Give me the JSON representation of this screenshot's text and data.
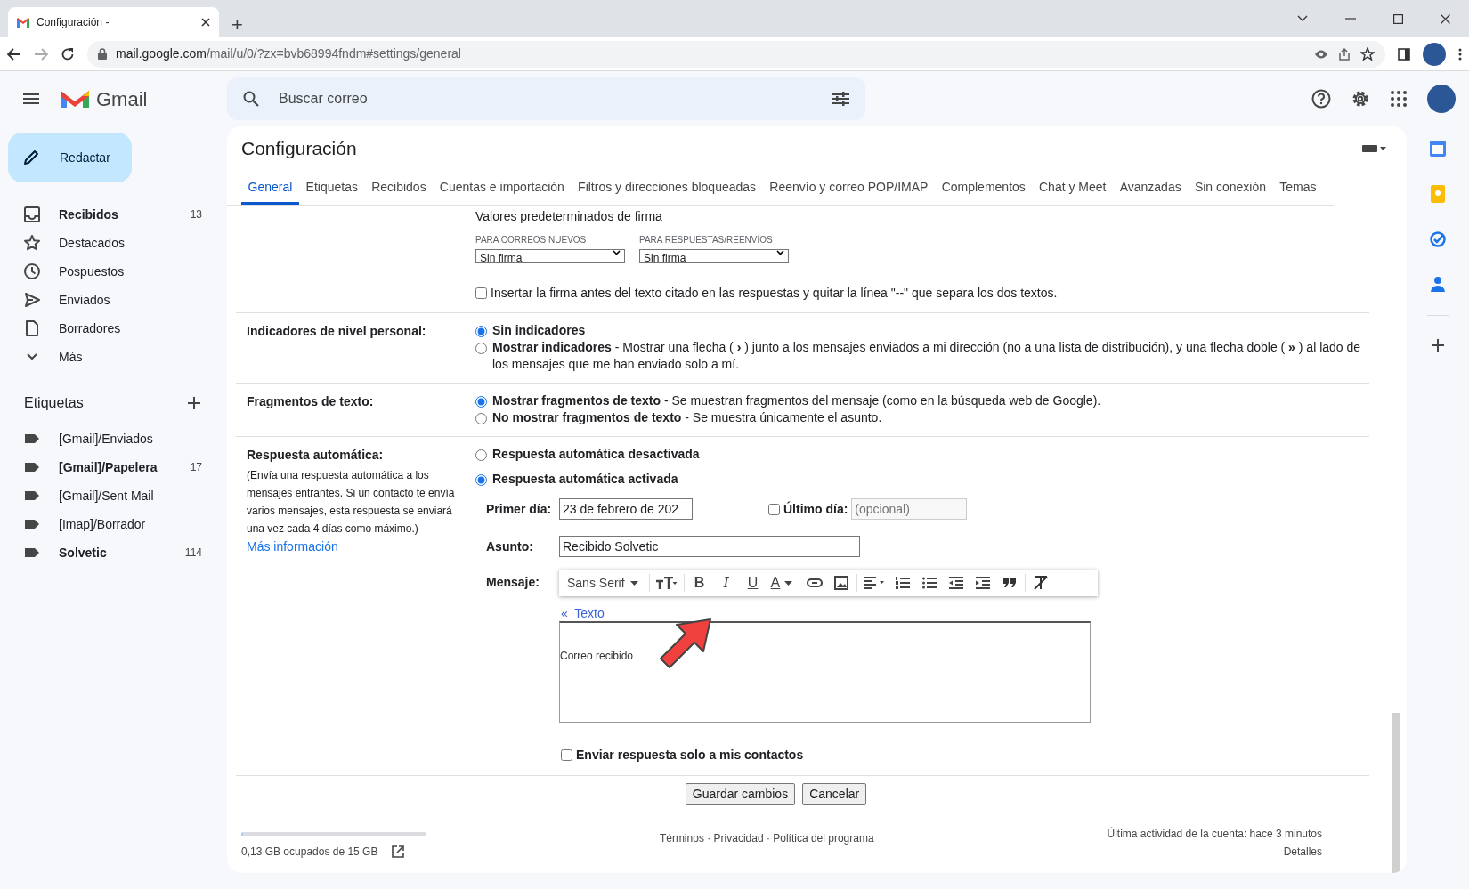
{
  "browser": {
    "tab_title": "Configuración -",
    "new_tab": "+",
    "url_host": "mail.google.com",
    "url_path": "/mail/u/0/?zx=bvb68994fndm#settings/general"
  },
  "app": {
    "name": "Gmail",
    "search": {
      "placeholder": "Buscar correo"
    }
  },
  "compose": {
    "label": "Redactar"
  },
  "sidebar": {
    "items": [
      {
        "label": "Recibidos",
        "count": "13",
        "unread": true
      },
      {
        "label": "Destacados",
        "unread": false
      },
      {
        "label": "Pospuestos",
        "unread": false
      },
      {
        "label": "Enviados",
        "unread": false
      },
      {
        "label": "Borradores",
        "unread": false
      },
      {
        "label": "Más",
        "unread": false
      }
    ],
    "labels_title": "Etiquetas",
    "labels": [
      {
        "label": "[Gmail]/Enviados",
        "unread": false
      },
      {
        "label": "[Gmail]/Papelera",
        "count": "17",
        "unread": true
      },
      {
        "label": "[Gmail]/Sent Mail",
        "unread": false
      },
      {
        "label": "[Imap]/Borrador",
        "unread": false
      },
      {
        "label": "Solvetic",
        "count": "114",
        "unread": true
      }
    ]
  },
  "settings": {
    "title": "Configuración",
    "tabs": [
      {
        "label": "General",
        "selected": true
      },
      {
        "label": "Etiquetas",
        "selected": false
      },
      {
        "label": "Recibidos",
        "selected": false
      },
      {
        "label": "Cuentas e importación",
        "selected": false
      },
      {
        "label": "Filtros y direcciones bloqueadas",
        "selected": false
      },
      {
        "label": "Reenvío y correo POP/IMAP",
        "selected": false
      },
      {
        "label": "Complementos",
        "selected": false
      },
      {
        "label": "Chat y Meet",
        "selected": false
      },
      {
        "label": "Avanzadas",
        "selected": false
      },
      {
        "label": "Sin conexión",
        "selected": false
      },
      {
        "label": "Temas",
        "selected": false
      }
    ],
    "signature": {
      "title": "Valores predeterminados de firma",
      "new_label": "PARA CORREOS NUEVOS",
      "new_value": "Sin firma",
      "reply_label": "PARA RESPUESTAS/REENVÍOS",
      "reply_value": "Sin firma",
      "insert_before": {
        "label": "Insertar la firma antes del texto citado en las respuestas y quitar la línea \"--\" que separa los dos textos.",
        "checked": false
      }
    },
    "sections": [
      {
        "label": "Indicadores de nivel personal:",
        "options": [
          {
            "text": "**Sin indicadores**",
            "selected": true
          },
          {
            "text": "**Mostrar indicadores** - Mostrar una flecha ( **›** ) junto a los mensajes enviados a mi dirección (no a una lista de distribución), y una flecha doble ( **»** ) al lado de los mensajes que me han enviado solo a mí.",
            "selected": false
          }
        ]
      },
      {
        "label": "Fragmentos de texto:",
        "options": [
          {
            "text": "**Mostrar fragmentos de texto** - Se muestran fragmentos del mensaje (como en la búsqueda web de Google).",
            "selected": true
          },
          {
            "text": "**No mostrar fragmentos de texto** - Se muestra únicamente el asunto.",
            "selected": false
          }
        ]
      }
    ],
    "vacation": {
      "label": "Respuesta automática:",
      "description": "(Envía una respuesta automática a los mensajes entrantes. Si un contacto te envía varios mensajes, esta respuesta se enviará una vez cada 4 días como máximo.)",
      "link": "Más información",
      "options": [
        {
          "text": "Respuesta automática desactivada",
          "selected": false
        },
        {
          "text": "Respuesta automática activada",
          "selected": true
        }
      ],
      "first_day_label": "Primer día:",
      "first_day_value": "23 de febrero de 202",
      "last_day": {
        "label": "Último día:",
        "checked": false,
        "placeholder": "(opcional)"
      },
      "subject_label": "Asunto:",
      "subject_value": "Recibido Solvetic",
      "message_label": "Mensaje:",
      "toolbar": [
        {
          "kind": "font",
          "text": "Sans Serif"
        },
        {
          "kind": "size"
        },
        {
          "kind": "bold",
          "text": "B"
        },
        {
          "kind": "italic",
          "text": "I"
        },
        {
          "kind": "underline",
          "text": "U"
        },
        {
          "kind": "color",
          "text": "A"
        },
        {
          "kind": "link"
        },
        {
          "kind": "image"
        },
        {
          "kind": "align"
        },
        {
          "kind": "numbered"
        },
        {
          "kind": "bulleted"
        },
        {
          "kind": "outdent"
        },
        {
          "kind": "indent"
        },
        {
          "kind": "quote"
        },
        {
          "kind": "clear"
        }
      ],
      "plain_text_link": "«  Texto",
      "message_body": "Correo recibido",
      "contacts_only": {
        "label": "Enviar respuesta solo a mis contactos",
        "checked": false
      }
    },
    "buttons": [
      "Guardar cambios",
      "Cancelar"
    ]
  },
  "footer": {
    "storage": {
      "text": "0,13 GB ocupados de 15 GB",
      "level": 0.01
    },
    "links": "Términos · Privacidad · Política del programa",
    "activity": "Última actividad de la cuenta: hace 3 minutos",
    "details": "Detalles"
  }
}
